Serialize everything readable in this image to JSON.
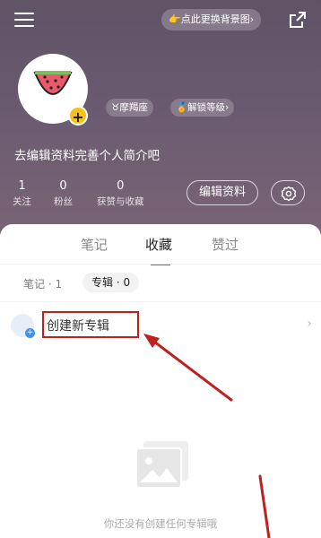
{
  "header": {
    "bg_pill_label": "👉点此更换背景图›",
    "tags": {
      "star": "♉摩羯座",
      "level": "🏅解锁等级›"
    },
    "bio": "去编辑资料完善个人简介吧",
    "stats": [
      {
        "num": "1",
        "label": "关注"
      },
      {
        "num": "0",
        "label": "粉丝"
      },
      {
        "num": "0",
        "label": "获赞与收藏"
      }
    ],
    "edit_label": "编辑资料"
  },
  "tabs": {
    "notes": "笔记",
    "collect": "收藏",
    "liked": "赞过"
  },
  "subtabs": {
    "notes": "笔记 · 1",
    "album": "专辑 · 0"
  },
  "create": {
    "label": "创建新专辑",
    "chevron": "›"
  },
  "empty": {
    "text": "你还没有创建任何专辑哦"
  },
  "colors": {
    "accent": "#e8344b",
    "annotation": "#c0201f",
    "header_bg": "#5f5366",
    "badge": "#f5c11a"
  }
}
